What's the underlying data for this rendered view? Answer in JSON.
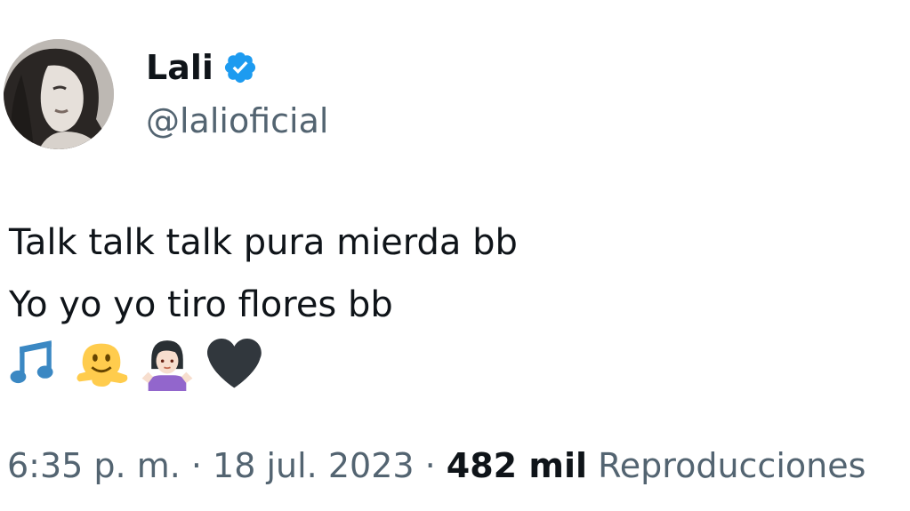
{
  "author": {
    "display_name": "Lali",
    "handle": "@lalioficial",
    "verified_color": "#1d9bf0"
  },
  "tweet": {
    "lines": [
      "Talk talk talk pura mierda bb",
      "Yo yo yo tiro flores bb"
    ],
    "emojis": [
      "musical-notes-icon",
      "melting-face-icon",
      "woman-shrugging-icon",
      "black-heart-icon"
    ]
  },
  "meta": {
    "time": "6:35 p. m.",
    "separator": " · ",
    "date": "18 jul. 2023",
    "views_count": "482 mil",
    "views_label": "Reproducciones"
  }
}
